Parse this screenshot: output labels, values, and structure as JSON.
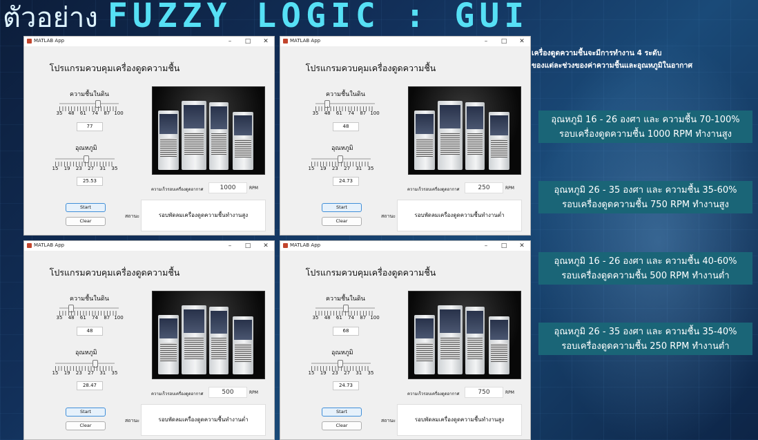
{
  "header": {
    "title_thai": "ตัวอย่าง",
    "title_en": "FUZZY LOGIC : GUI"
  },
  "description": {
    "line1": "เครื่องดูดความชื้นจะมีการทำงาน 4 ระดับ",
    "line2": "ของแต่ละช่วงของค่าความชื้นและอุณหภูมิในอากาศ"
  },
  "rules": [
    {
      "line1": "อุณหภูมิ 16 - 26 องศา และ ความชื้น 70-100%",
      "line2": "รอบเครื่องดูดความชื้น 1000 RPM ทำงานสูง"
    },
    {
      "line1": "อุณหภูมิ 26 - 35 องศา และ ความชื้น 35-60%",
      "line2": "รอบเครื่องดูดความชื้น 750 RPM ทำงานสูง"
    },
    {
      "line1": "อุณหภูมิ 16 - 26 องศา และ ความชื้น 40-60%",
      "line2": "รอบเครื่องดูดความชื้น 500 RPM ทำงานต่ำ"
    },
    {
      "line1": "อุณหภูมิ 26 - 35  องศา และ ความชื้น 35-40%",
      "line2": "รอบเครื่องดูดความชื้น 250 RPM ทำงานต่ำ"
    }
  ],
  "windows": [
    {
      "window_title": "MATLAB App",
      "app_title": "โปรแกรมควบคุมเครื่องดูดความชื้น",
      "humidity_label": "ความชื้นในดิน",
      "humidity_ticks": [
        "35",
        "48",
        "61",
        "74",
        "87",
        "100"
      ],
      "humidity_value": "77",
      "temp_label": "อุณหภูมิ",
      "temp_ticks": [
        "15",
        "19",
        "23",
        "27",
        "31",
        "35"
      ],
      "temp_value": "25.53",
      "speed_label": "ความเร็วรอบเครื่องดูดอากาศ",
      "speed_value": "1000",
      "speed_unit": "RPM",
      "start_label": "Start",
      "clear_label": "Clear",
      "status_label": "สถานะ",
      "status_text": "รอบพัดลมเครื่องดูดความชื้นทำงานสูง"
    },
    {
      "window_title": "MATLAB App",
      "app_title": "โปรแกรมควบคุมเครื่องดูดความชื้น",
      "humidity_label": "ความชื้นในดิน",
      "humidity_ticks": [
        "35",
        "48",
        "61",
        "74",
        "87",
        "100"
      ],
      "humidity_value": "48",
      "temp_label": "อุณหภูมิ",
      "temp_ticks": [
        "15",
        "19",
        "23",
        "27",
        "31",
        "35"
      ],
      "temp_value": "24.73",
      "speed_label": "ความเร็วรอบเครื่องดูดอากาศ",
      "speed_value": "250",
      "speed_unit": "RPM",
      "start_label": "Start",
      "clear_label": "Clear",
      "status_label": "สถานะ",
      "status_text": "รอบพัดลมเครื่องดูดความชื้นทำงานต่ำ"
    },
    {
      "window_title": "MATLAB App",
      "app_title": "โปรแกรมควบคุมเครื่องดูดความชื้น",
      "humidity_label": "ความชื้นในดิน",
      "humidity_ticks": [
        "35",
        "48",
        "61",
        "74",
        "87",
        "100"
      ],
      "humidity_value": "48",
      "temp_label": "อุณหภูมิ",
      "temp_ticks": [
        "15",
        "19",
        "23",
        "27",
        "31",
        "35"
      ],
      "temp_value": "28.47",
      "speed_label": "ความเร็วรอบเครื่องดูดอากาศ",
      "speed_value": "500",
      "speed_unit": "RPM",
      "start_label": "Start",
      "clear_label": "Clear",
      "status_label": "สถานะ",
      "status_text": "รอบพัดลมเครื่องดูดความชื้นทำงานต่ำ"
    },
    {
      "window_title": "MATLAB App",
      "app_title": "โปรแกรมควบคุมเครื่องดูดความชื้น",
      "humidity_label": "ความชื้นในดิน",
      "humidity_ticks": [
        "35",
        "48",
        "61",
        "74",
        "87",
        "100"
      ],
      "humidity_value": "68",
      "temp_label": "อุณหภูมิ",
      "temp_ticks": [
        "15",
        "19",
        "23",
        "27",
        "31",
        "35"
      ],
      "temp_value": "24.73",
      "speed_label": "ความเร็วรอบเครื่องดูดอากาศ",
      "speed_value": "750",
      "speed_unit": "RPM",
      "start_label": "Start",
      "clear_label": "Clear",
      "status_label": "สถานะ",
      "status_text": "รอบพัดลมเครื่องดูดความชื้นทำงานสูง"
    }
  ]
}
